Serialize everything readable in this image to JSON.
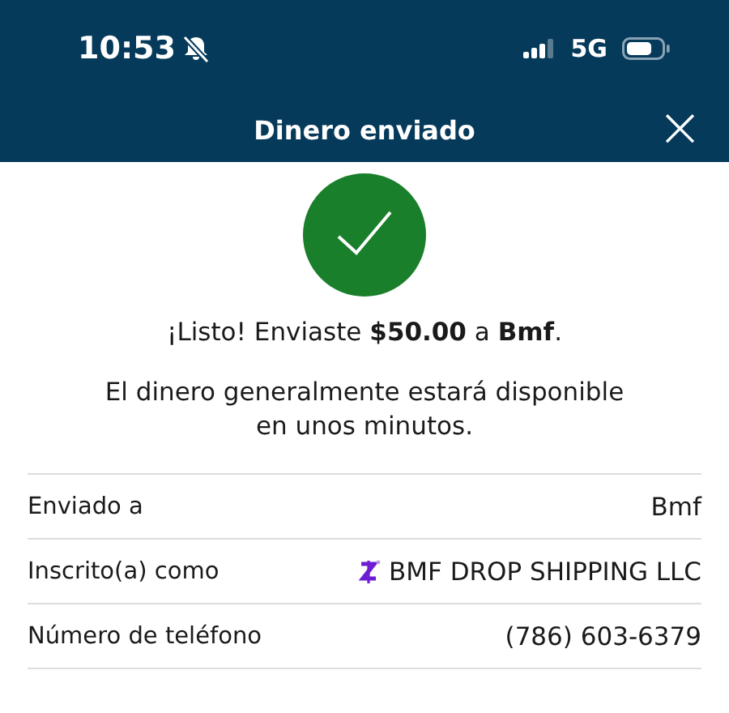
{
  "status_bar": {
    "time": "10:53",
    "network": "5G"
  },
  "header": {
    "title": "Dinero enviado",
    "close": "×"
  },
  "confirmation": {
    "headline": "¡Listo! Enviaste **$50.00** a **Bmf**.",
    "note": "El dinero generalmente estará disponible en unos minutos."
  },
  "details": [
    {
      "kind": "plain",
      "label": "Enviado a",
      "value": "Bmf"
    },
    {
      "kind": "enrolled",
      "label": "Inscrito(a) como",
      "value": "BMF DROP SHIPPING LLC"
    },
    {
      "kind": "plain",
      "label": "Número de teléfono",
      "value": "(786) 603-6379"
    }
  ]
}
